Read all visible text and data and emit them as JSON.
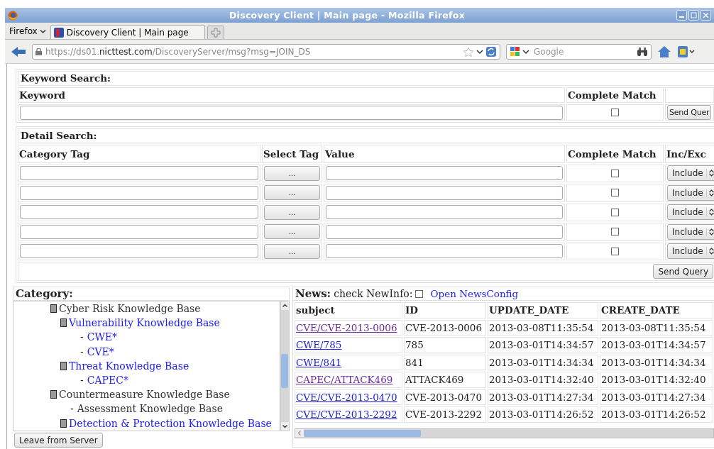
{
  "window": {
    "title": "Discovery Client | Main page - Mozilla Firefox"
  },
  "browser": {
    "menu": "Firefox",
    "tabs": [
      {
        "label": "Discovery Client | Main page",
        "selected": true
      }
    ],
    "url_host": "https://ds01.",
    "url_domain": "nicttest.com",
    "url_path": "/DiscoveryServer/msg?msg=JOIN_DS",
    "search_placeholder": "Google"
  },
  "keyword_search": {
    "title": "Keyword Search:",
    "col_keyword": "Keyword",
    "col_match": "Complete Match",
    "complete_match": false,
    "button": "Send Quer"
  },
  "detail_search": {
    "title": "Detail Search:",
    "columns": [
      "Category Tag",
      "Select Tag",
      "Value",
      "Complete Match",
      "Inc/Exc"
    ],
    "rows": [
      {
        "select_button": "...",
        "complete_match": false,
        "inc_exc": "Include"
      },
      {
        "select_button": "...",
        "complete_match": false,
        "inc_exc": "Include"
      },
      {
        "select_button": "...",
        "complete_match": false,
        "inc_exc": "Include"
      },
      {
        "select_button": "...",
        "complete_match": false,
        "inc_exc": "Include"
      },
      {
        "select_button": "...",
        "complete_match": false,
        "inc_exc": "Include"
      }
    ],
    "button": "Send Query"
  },
  "category": {
    "title": "Category:",
    "tree": [
      {
        "label": "Cyber Risk Knowledge Base",
        "link": false,
        "expanded": true,
        "children": [
          {
            "label": "Vulnerability Knowledge Base",
            "link": true,
            "expanded": true,
            "children": [
              {
                "label": "CWE*",
                "link": true,
                "bullet": "-"
              },
              {
                "label": "CVE*",
                "link": true,
                "bullet": "-"
              }
            ]
          },
          {
            "label": "Threat Knowledge Base",
            "link": true,
            "expanded": true,
            "children": [
              {
                "label": "CAPEC*",
                "link": true,
                "bullet": "-"
              }
            ]
          }
        ]
      },
      {
        "label": "Countermeasure Knowledge Base",
        "link": false,
        "expanded": true,
        "children": [
          {
            "label": "Assessment Knowledge Base",
            "link": false,
            "bullet": "-"
          },
          {
            "label": "Detection & Protection Knowledge Base",
            "link": true,
            "expanded": true
          }
        ]
      }
    ]
  },
  "news": {
    "title": "News:",
    "check_label": "check NewInfo:",
    "check_newinfo": false,
    "config_link": "Open NewsConfig",
    "columns": [
      "subject",
      "ID",
      "UPDATE_DATE",
      "CREATE_DATE"
    ],
    "rows": [
      {
        "subject": "CVE/CVE-2013-0006",
        "visited": true,
        "id": "CVE-2013-0006",
        "update_date": "2013-03-08T11:35:54",
        "create_date": "2013-03-08T11:35:54"
      },
      {
        "subject": "CWE/785",
        "visited": false,
        "id": "785",
        "update_date": "2013-03-01T14:34:57",
        "create_date": "2013-03-01T14:34:57"
      },
      {
        "subject": "CWE/841",
        "visited": false,
        "id": "841",
        "update_date": "2013-03-01T14:34:34",
        "create_date": "2013-03-01T14:34:34"
      },
      {
        "subject": "CAPEC/ATTACK469",
        "visited": true,
        "id": "ATTACK469",
        "update_date": "2013-03-01T14:32:40",
        "create_date": "2013-03-01T14:32:40"
      },
      {
        "subject": "CVE/CVE-2013-0470",
        "visited": false,
        "id": "CVE-2013-0470",
        "update_date": "2013-03-01T14:27:34",
        "create_date": "2013-03-01T14:27:34"
      },
      {
        "subject": "CVE/CVE-2013-2292",
        "visited": false,
        "id": "CVE-2013-2292",
        "update_date": "2013-03-01T14:26:52",
        "create_date": "2013-03-01T14:26:52"
      }
    ]
  },
  "leave_button": "Leave from Server"
}
